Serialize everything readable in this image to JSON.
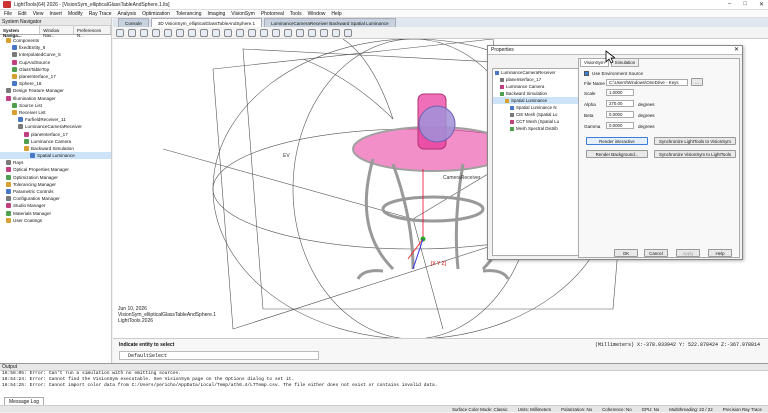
{
  "app": {
    "title": "LightTools(64) 2026 - [VisionSym_ellipticalGlassTableAndSphere.1.lts]"
  },
  "menu": [
    "File",
    "Edit",
    "View",
    "Insert",
    "Modify",
    "Ray Trace",
    "Analysis",
    "Optimization",
    "Tolerancing",
    "Imaging",
    "VisionSym",
    "Photorreal",
    "Tools",
    "Window",
    "Help"
  ],
  "sidebar": {
    "header": "System Navigator",
    "tabs": [
      "System Naviga...",
      "Window Nav...",
      "Preferences N..."
    ],
    "tree": [
      {
        "label": "Components",
        "indent": 1
      },
      {
        "label": "fixedEntity_6",
        "indent": 2
      },
      {
        "label": "InterpolatedCurve_5",
        "indent": 2
      },
      {
        "label": "CupAndSource",
        "indent": 2
      },
      {
        "label": "GlassTableTop",
        "indent": 2
      },
      {
        "label": "planeInterface_17",
        "indent": 2
      },
      {
        "label": "Sphere_18",
        "indent": 2
      },
      {
        "label": "Design Feature Manager",
        "indent": 1
      },
      {
        "label": "Illumination Manager",
        "indent": 1
      },
      {
        "label": "Source List",
        "indent": 2
      },
      {
        "label": "Receiver List",
        "indent": 2
      },
      {
        "label": "FarfieldReceiver_11",
        "indent": 3
      },
      {
        "label": "LuminanceCameraReceiver",
        "indent": 3
      },
      {
        "label": "planeInterface_17",
        "indent": 4
      },
      {
        "label": "Luminance Camera",
        "indent": 4
      },
      {
        "label": "Backward Simulation",
        "indent": 4
      },
      {
        "label": "Spatial Luminance",
        "indent": 5,
        "selected": true
      },
      {
        "label": "Rays",
        "indent": 1
      },
      {
        "label": "Optical Properties Manager",
        "indent": 1
      },
      {
        "label": "Optimization Manager",
        "indent": 1
      },
      {
        "label": "Tolerancing Manager",
        "indent": 1
      },
      {
        "label": "Parametric Controls",
        "indent": 1
      },
      {
        "label": "Configuration Manager",
        "indent": 1
      },
      {
        "label": "Studio Manager",
        "indent": 1
      },
      {
        "label": "Materials Manager",
        "indent": 1
      },
      {
        "label": "User Coatings",
        "indent": 1
      }
    ]
  },
  "doctabs": [
    "Console",
    "3D VisionSym_ellipticalGlassTableAndSphere.1",
    "LuminanceCameraReceiver Backward Spatial Luminance"
  ],
  "viewport": {
    "info": [
      "Jun 10, 2026",
      "VisionSym_ellipticalGlassTableAndSphere.1",
      "LightTools 2026"
    ],
    "labels": {
      "ev": "EV",
      "receiver": "CameraReceiver",
      "xyz": "[X Y Z]"
    }
  },
  "command": {
    "label": "Indicate entity to select",
    "value": "DefaultSelect",
    "coords": "(Millimeters) X:-378.933942 Y: 522.878424 Z:-367.978814"
  },
  "output": {
    "header": "Output",
    "lines": [
      "16:58:05: Error: Can't run a simulation with no emitting sources.",
      "16:54:24: Error: Cannot find the VisionSym executable.  See VisionSym page on the Options dialog to set it.",
      "16:54:25: Error: Cannot import color data from C:/Users/pericho/AppData/Local/Temp/ath6.4/LTTemp.csv. The file either does not exist or contains invalid data."
    ],
    "tab": "Message Log"
  },
  "status": {
    "items": [
      "Surface Color Mode: Classic",
      "Units: Millimeters",
      "Polarization: No",
      "Coherence: No",
      "GPU: No",
      "Multithreading: 22 / 22",
      "Precision Ray Trace"
    ]
  },
  "properties": {
    "title": "Properties",
    "tree": [
      {
        "label": "LuminanceCameraReceiver",
        "indent": 0
      },
      {
        "label": "planeInterface_17",
        "indent": 1
      },
      {
        "label": "Luminance Camera",
        "indent": 1
      },
      {
        "label": "Backward Simulation",
        "indent": 1
      },
      {
        "label": "Spatial Luminance",
        "indent": 2,
        "selected": true
      },
      {
        "label": "Spatial Luminance N",
        "indent": 3
      },
      {
        "label": "CIE Mesh (Spatial Lu",
        "indent": 3
      },
      {
        "label": "CCT Mesh (Spatial Lu",
        "indent": 3
      },
      {
        "label": "Mesh Spectral Distrib",
        "indent": 3
      }
    ],
    "tabs": [
      "VisionSym",
      "Simulation"
    ],
    "use_env": "Use Environment Source",
    "file_label": "File Name",
    "file_value": "C:\\Users\\Windows\\OneDrive - Keys",
    "browse": "...",
    "scale_label": "Scale",
    "scale_value": "1.0000",
    "alpha_label": "Alpha",
    "alpha_value": "270.00",
    "beta_label": "Beta",
    "beta_value": "0.0000",
    "gamma_label": "Gamma",
    "gamma_value": "0.0000",
    "deg": "degrees",
    "btn_render": "Render interactive",
    "btn_sync1": "Synchronize LightTools to VisionSym",
    "btn_bg": "Render Background...",
    "btn_sync2": "Synchronize VisionSym to LightTools",
    "ok": "OK",
    "cancel": "Cancel",
    "apply": "Apply",
    "help": "Help"
  }
}
